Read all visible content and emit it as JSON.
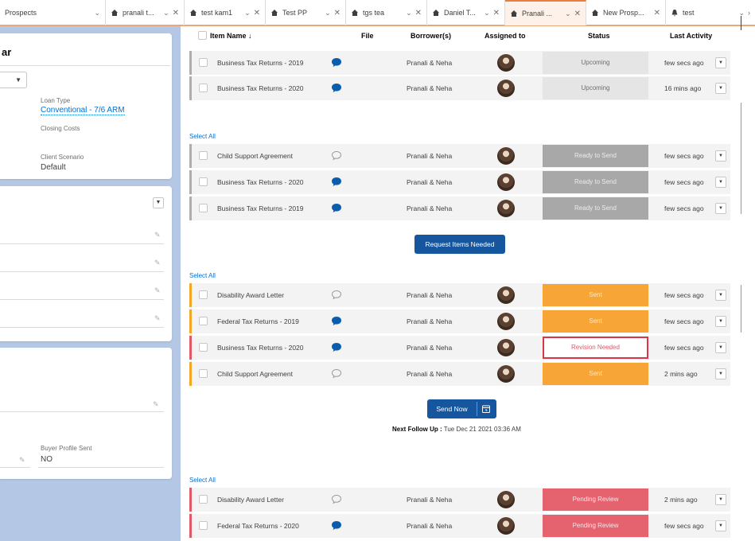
{
  "tabs": [
    {
      "label": "Prospects",
      "icon": "none",
      "active": false
    },
    {
      "label": "pranali t...",
      "icon": "home-icon",
      "active": false
    },
    {
      "label": "test kam1",
      "icon": "home-icon",
      "active": false
    },
    {
      "label": "Test PP",
      "icon": "home-icon",
      "active": false
    },
    {
      "label": "tgs tea",
      "icon": "home-icon",
      "active": false
    },
    {
      "label": "Daniel T...",
      "icon": "home-icon",
      "active": false
    },
    {
      "label": "Pranali ...",
      "icon": "home-icon",
      "active": true
    },
    {
      "label": "New Prosp...",
      "icon": "home-icon",
      "active": false
    },
    {
      "label": "test",
      "icon": "bell-icon",
      "active": false
    }
  ],
  "left_panel": {
    "card1": {
      "title_fragment": "ar",
      "loan_type_label": "Loan Type",
      "loan_type_value": "Conventional - 7/6 ARM",
      "closing_costs_label": "Closing Costs",
      "client_scenario_label": "Client Scenario",
      "client_scenario_value": "Default"
    },
    "card3": {
      "buyer_profile_label": "Buyer Profile Sent",
      "buyer_profile_value": "NO"
    }
  },
  "table_header": {
    "item_name": "Item Name ↓",
    "file": "File",
    "borrowers": "Borrower(s)",
    "assigned_to": "Assigned to",
    "status": "Status",
    "last_activity": "Last Activity"
  },
  "groups": [
    {
      "select_all": "",
      "rows": [
        {
          "name": "Business Tax Returns - 2019",
          "file": "filled",
          "borrower": "Pranali & Neha",
          "status": "Upcoming",
          "status_type": "upcoming",
          "activity": "few secs ago"
        },
        {
          "name": "Business Tax Returns - 2020",
          "file": "filled",
          "borrower": "Pranali & Neha",
          "status": "Upcoming",
          "status_type": "upcoming",
          "activity": "16 mins ago"
        }
      ]
    },
    {
      "select_all": "Select All",
      "rows": [
        {
          "name": "Child Support Agreement",
          "file": "outline",
          "borrower": "Pranali & Neha",
          "status": "Ready to Send",
          "status_type": "ready",
          "activity": "few secs ago"
        },
        {
          "name": "Business Tax Returns - 2020",
          "file": "filled",
          "borrower": "Pranali & Neha",
          "status": "Ready to Send",
          "status_type": "ready",
          "activity": "few secs ago"
        },
        {
          "name": "Business Tax Returns - 2019",
          "file": "filled",
          "borrower": "Pranali & Neha",
          "status": "Ready to Send",
          "status_type": "ready",
          "activity": "few secs ago"
        }
      ]
    },
    {
      "select_all": "Select All",
      "rows": [
        {
          "name": "Disability Award Letter",
          "file": "outline",
          "borrower": "Pranali & Neha",
          "status": "Sent",
          "status_type": "sent",
          "activity": "few secs ago"
        },
        {
          "name": "Federal Tax Returns - 2019",
          "file": "filled",
          "borrower": "Pranali & Neha",
          "status": "Sent",
          "status_type": "sent",
          "activity": "few secs ago"
        },
        {
          "name": "Business Tax Returns - 2020",
          "file": "filled",
          "borrower": "Pranali & Neha",
          "status": "Revision Needed",
          "status_type": "revision",
          "activity": "few secs ago"
        },
        {
          "name": "Child Support Agreement",
          "file": "outline",
          "borrower": "Pranali & Neha",
          "status": "Sent",
          "status_type": "sent",
          "activity": "2 mins ago"
        }
      ]
    },
    {
      "select_all": "Select All",
      "rows": [
        {
          "name": "Disability Award Letter",
          "file": "outline",
          "borrower": "Pranali & Neha",
          "status": "Pending Review",
          "status_type": "pending",
          "activity": "2 mins ago"
        },
        {
          "name": "Federal Tax Returns - 2020",
          "file": "filled",
          "borrower": "Pranali & Neha",
          "status": "Pending Review",
          "status_type": "pending",
          "activity": "few secs ago"
        }
      ]
    }
  ],
  "buttons": {
    "request_items": "Request Items Needed",
    "send_now": "Send Now"
  },
  "follow_up": {
    "label": "Next Follow Up :",
    "value": "Tue Dec 21 2021 03:36 AM"
  },
  "colors": {
    "ready": "#a8a8a8",
    "sent": "#f7a536",
    "pending": "#e5626f",
    "revision_border": "#d9364a",
    "primary_button": "#16569e",
    "left_bg": "#b4c8e6"
  }
}
